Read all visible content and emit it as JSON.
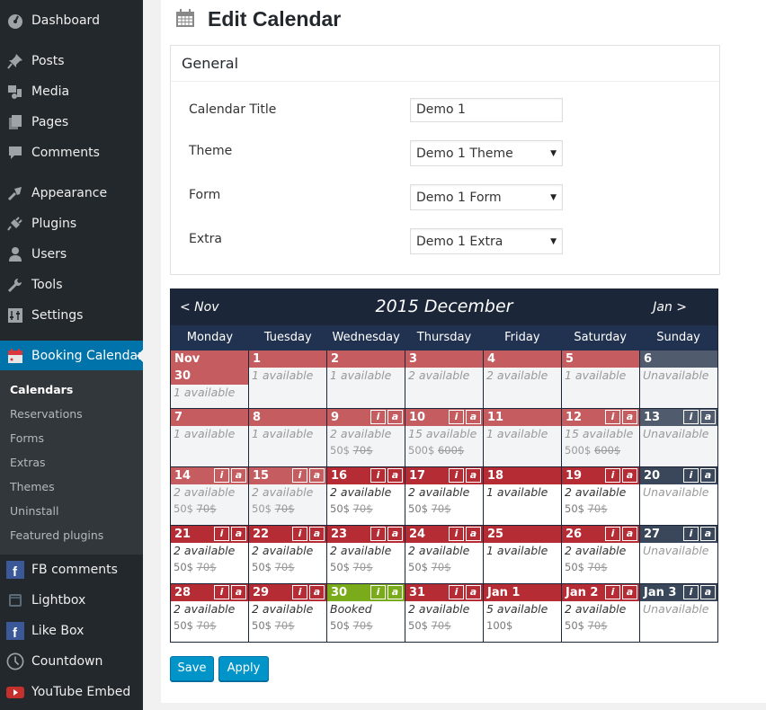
{
  "sidebar": {
    "items": [
      {
        "label": "Dashboard",
        "icon": "dashboard-icon"
      },
      {
        "label": "Posts",
        "icon": "pushpin-icon"
      },
      {
        "label": "Media",
        "icon": "media-icon"
      },
      {
        "label": "Pages",
        "icon": "pages-icon"
      },
      {
        "label": "Comments",
        "icon": "comment-icon"
      },
      {
        "label": "Appearance",
        "icon": "paintbrush-icon"
      },
      {
        "label": "Plugins",
        "icon": "plugin-icon"
      },
      {
        "label": "Users",
        "icon": "user-icon"
      },
      {
        "label": "Tools",
        "icon": "wrench-icon"
      },
      {
        "label": "Settings",
        "icon": "settings-icon"
      },
      {
        "label": "Booking Calendar",
        "icon": "calendar-icon",
        "active": true
      }
    ],
    "submenu": [
      {
        "label": "Calendars",
        "current": true
      },
      {
        "label": "Reservations"
      },
      {
        "label": "Forms"
      },
      {
        "label": "Extras"
      },
      {
        "label": "Themes"
      },
      {
        "label": "Uninstall"
      },
      {
        "label": "Featured plugins"
      }
    ],
    "extra_items": [
      {
        "label": "FB comments",
        "icon": "facebook-icon"
      },
      {
        "label": "Lightbox",
        "icon": "lightbox-icon"
      },
      {
        "label": "Like Box",
        "icon": "facebook-icon"
      },
      {
        "label": "Countdown",
        "icon": "clock-icon"
      },
      {
        "label": "YouTube Embed",
        "icon": "youtube-icon"
      }
    ]
  },
  "page": {
    "title": "Edit Calendar",
    "general": {
      "heading": "General",
      "fields": [
        {
          "label": "Calendar Title",
          "value": "Demo 1",
          "type": "text"
        },
        {
          "label": "Theme",
          "value": "Demo 1 Theme",
          "type": "select"
        },
        {
          "label": "Form",
          "value": "Demo 1 Form",
          "type": "select"
        },
        {
          "label": "Extra",
          "value": "Demo 1 Extra",
          "type": "select"
        }
      ]
    },
    "calendar": {
      "prev": "< Nov",
      "title": "2015 December",
      "next": "Jan >",
      "weekdays": [
        "Monday",
        "Tuesday",
        "Wednesday",
        "Thursday",
        "Friday",
        "Saturday",
        "Sunday"
      ],
      "badge_info": "i",
      "badge_add": "a",
      "days": [
        {
          "label": "Nov 30",
          "state": "past",
          "status": "1 available",
          "badges": false
        },
        {
          "label": "1",
          "state": "past",
          "status": "1 available",
          "badges": false
        },
        {
          "label": "2",
          "state": "past",
          "status": "1 available",
          "badges": false
        },
        {
          "label": "3",
          "state": "past",
          "status": "2 available",
          "badges": false
        },
        {
          "label": "4",
          "state": "past",
          "status": "2 available",
          "badges": false
        },
        {
          "label": "5",
          "state": "past",
          "status": "1 available",
          "badges": false
        },
        {
          "label": "6",
          "state": "unavail-past",
          "status": "Unavailable",
          "badges": false
        },
        {
          "label": "7",
          "state": "past",
          "status": "1 available",
          "badges": false
        },
        {
          "label": "8",
          "state": "past",
          "status": "1 available",
          "badges": false
        },
        {
          "label": "9",
          "state": "past",
          "status": "2 available",
          "price": "50$",
          "old_price": "70$",
          "badges": true
        },
        {
          "label": "10",
          "state": "past",
          "status": "15 available",
          "price": "500$",
          "old_price": "600$",
          "badges": true
        },
        {
          "label": "11",
          "state": "past",
          "status": "1 available",
          "badges": false
        },
        {
          "label": "12",
          "state": "past",
          "status": "15 available",
          "price": "500$",
          "old_price": "600$",
          "badges": true
        },
        {
          "label": "13",
          "state": "unavail-past",
          "status": "Unavailable",
          "badges": true
        },
        {
          "label": "14",
          "state": "past",
          "status": "2 available",
          "price": "50$",
          "old_price": "70$",
          "badges": true
        },
        {
          "label": "15",
          "state": "past",
          "status": "2 available",
          "price": "50$",
          "old_price": "70$",
          "badges": true
        },
        {
          "label": "16",
          "state": "avail",
          "status": "2 available",
          "price": "50$",
          "old_price": "70$",
          "badges": true
        },
        {
          "label": "17",
          "state": "avail",
          "status": "2 available",
          "price": "50$",
          "old_price": "70$",
          "badges": true
        },
        {
          "label": "18",
          "state": "avail",
          "status": "1 available",
          "badges": false
        },
        {
          "label": "19",
          "state": "avail",
          "status": "2 available",
          "price": "50$",
          "old_price": "70$",
          "badges": true
        },
        {
          "label": "20",
          "state": "unavail",
          "status": "Unavailable",
          "badges": true
        },
        {
          "label": "21",
          "state": "avail",
          "status": "2 available",
          "price": "50$",
          "old_price": "70$",
          "badges": true
        },
        {
          "label": "22",
          "state": "avail",
          "status": "2 available",
          "price": "50$",
          "old_price": "70$",
          "badges": true
        },
        {
          "label": "23",
          "state": "avail",
          "status": "2 available",
          "price": "50$",
          "old_price": "70$",
          "badges": true
        },
        {
          "label": "24",
          "state": "avail",
          "status": "2 available",
          "price": "50$",
          "old_price": "70$",
          "badges": true
        },
        {
          "label": "25",
          "state": "avail",
          "status": "1 available",
          "badges": false
        },
        {
          "label": "26",
          "state": "avail",
          "status": "2 available",
          "price": "50$",
          "old_price": "70$",
          "badges": true
        },
        {
          "label": "27",
          "state": "unavail",
          "status": "Unavailable",
          "badges": true
        },
        {
          "label": "28",
          "state": "avail",
          "status": "2 available",
          "price": "50$",
          "old_price": "70$",
          "badges": true
        },
        {
          "label": "29",
          "state": "avail",
          "status": "2 available",
          "price": "50$",
          "old_price": "70$",
          "badges": true
        },
        {
          "label": "30",
          "state": "booked",
          "status": "Booked",
          "price": "50$",
          "old_price": "70$",
          "badges": true
        },
        {
          "label": "31",
          "state": "avail",
          "status": "2 available",
          "price": "50$",
          "old_price": "70$",
          "badges": true
        },
        {
          "label": "Jan 1",
          "state": "avail",
          "status": "5 available",
          "price": "100$",
          "badges": false
        },
        {
          "label": "Jan 2",
          "state": "avail",
          "status": "2 available",
          "price": "50$",
          "old_price": "70$",
          "badges": true
        },
        {
          "label": "Jan 3",
          "state": "unavail",
          "status": "Unavailable",
          "badges": true
        }
      ]
    },
    "buttons": {
      "save": "Save",
      "apply": "Apply"
    }
  },
  "colors": {
    "sidebar_bg": "#23282d",
    "active_menu": "#0073aa",
    "calendar_header": "#1b2638",
    "past_day": "#c55c60",
    "available_day": "#b52c35",
    "booked_day": "#7aab1b",
    "unavailable_day": "#3a475a",
    "button": "#0094c9"
  }
}
